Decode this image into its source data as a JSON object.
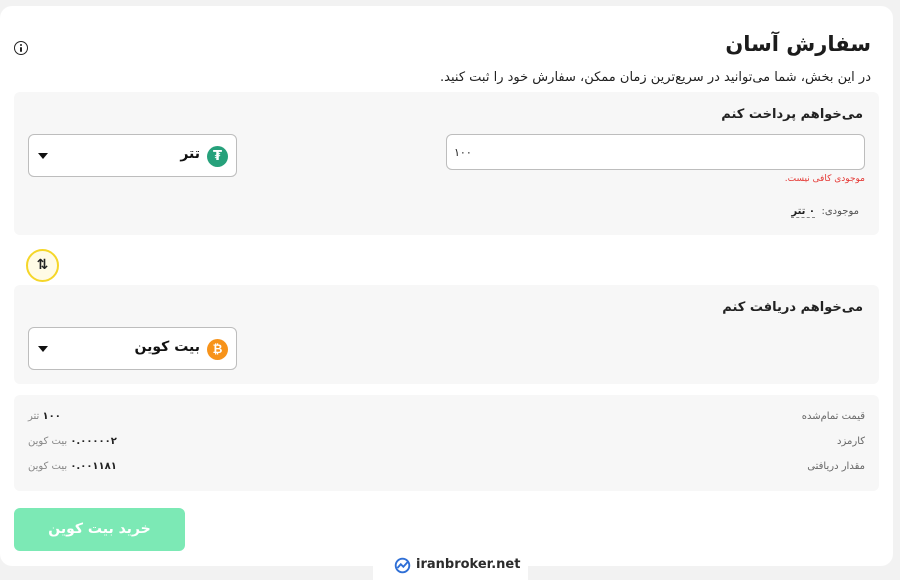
{
  "header": {
    "title": "سفارش آسان",
    "subtitle": "در این بخش، شما می‌توانید در سریع‌ترین زمان ممکن، سفارش خود را ثبت کنید."
  },
  "pay": {
    "label": "می‌خواهم پرداخت کنم",
    "amount": "۱۰۰",
    "coin": "تتر",
    "coin_symbol": "₮",
    "error": "موجودی کافی نیست.",
    "balance_label": "موجودی:",
    "balance_value": "۰ تتر"
  },
  "receive": {
    "label": "می‌خواهم دریافت کنم",
    "coin": "بیت کوین",
    "coin_symbol": "₿"
  },
  "summary": {
    "rows": [
      {
        "label": "قیمت تمام‌شده",
        "value": "۱۰۰",
        "unit": "تتر"
      },
      {
        "label": "کارمزد",
        "value": "۰.۰۰۰۰۰۲",
        "unit": "بیت کوین"
      },
      {
        "label": "مقدار دریافتی",
        "value": "۰.۰۰۱۱۸۱",
        "unit": "بیت کوین"
      }
    ]
  },
  "buy_button": "خرید بیت کوین",
  "swap_symbol": "⇅",
  "watermark": "iranbroker.net",
  "colors": {
    "usdt": "#26a17b",
    "btc": "#f7931a",
    "buy_button": "#7ce9b5",
    "error": "#e53935",
    "swap_border": "#f5d629"
  },
  "icons": {
    "info": "info-icon",
    "caret": "caret-down-icon",
    "swap": "swap-arrows-icon"
  }
}
